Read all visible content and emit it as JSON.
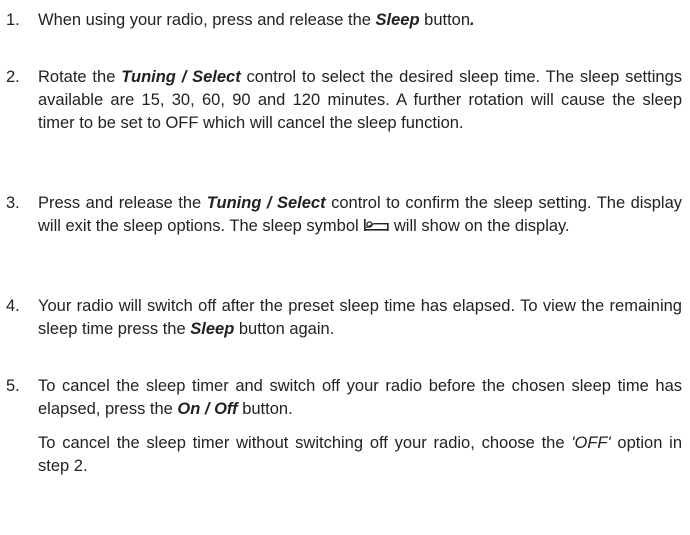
{
  "steps": [
    {
      "number": "1.",
      "a": "When using your radio, press and release the ",
      "b": "Sleep",
      "c": " button",
      "d": "."
    },
    {
      "number": "2.",
      "a": "Rotate the ",
      "b": "Tuning / Select",
      "c": " control to select the desired sleep time. The sleep settings available are 15, 30, 60, 90 and 120 minutes. A further rotation will cause the sleep timer to be set to OFF which will cancel the sleep function."
    },
    {
      "number": "3.",
      "a": "Press and release the ",
      "b": "Tuning / Select",
      "c": " control to confirm the sleep setting. The display will exit the sleep options. The sleep symbol ",
      "d": " will show on the display."
    },
    {
      "number": "4.",
      "a": "Your radio will switch off after the preset sleep time has elapsed. To view the remaining sleep time press the ",
      "b": "Sleep",
      "c": " button again."
    },
    {
      "number": "5.",
      "a": "To cancel the sleep timer and switch off your radio before the chosen sleep time has elapsed, press the ",
      "b": "On / Off",
      "c": " button.",
      "p2a": "To cancel the sleep timer without switching off your radio, choose the ",
      "p2b": "'OFF'",
      "p2c": " option in step 2."
    }
  ],
  "icon": "sleep-bed-icon"
}
